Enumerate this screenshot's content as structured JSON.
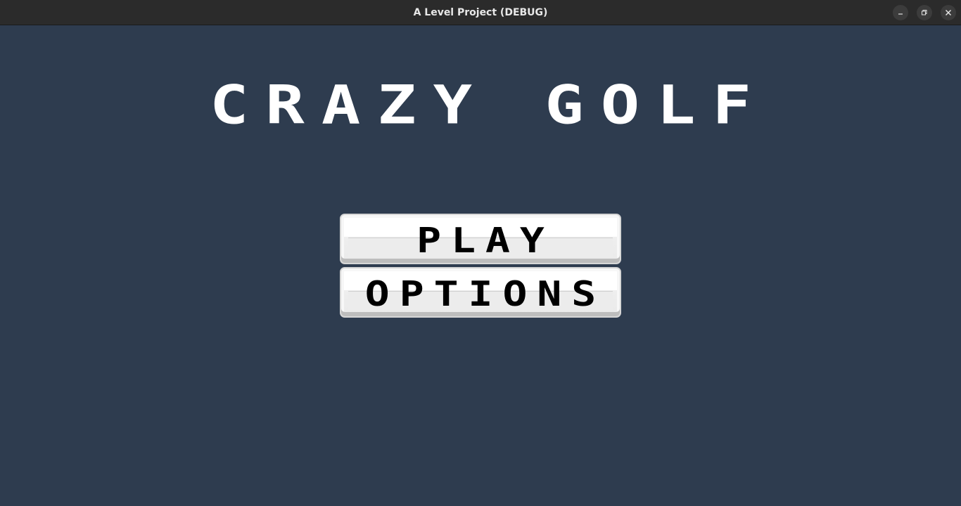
{
  "window": {
    "title": "A Level Project (DEBUG)",
    "controls": [
      "minimize-icon",
      "maximize-icon",
      "close-icon"
    ]
  },
  "game": {
    "title": "CRAZY GOLF",
    "menu": {
      "play_label": "PLAY",
      "options_label": "OPTIONS"
    }
  },
  "colors": {
    "background": "#2e3c4f",
    "titlebar": "#2b2b2b",
    "title_text": "#ffffff",
    "button_face": "#ffffff",
    "button_text": "#000000"
  }
}
